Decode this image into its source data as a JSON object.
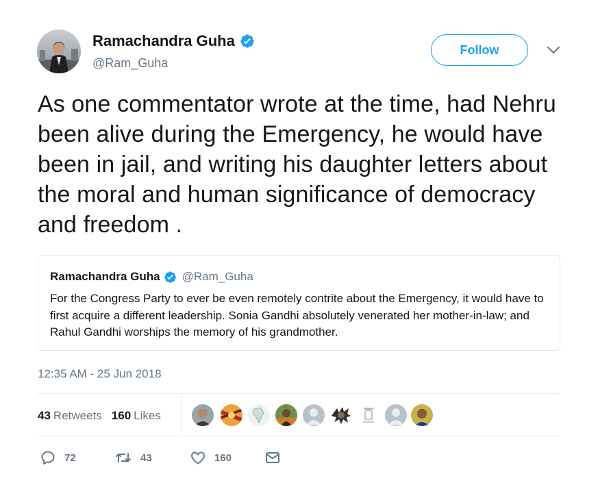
{
  "author": {
    "name": "Ramachandra Guha",
    "handle": "@Ram_Guha",
    "verified": true
  },
  "follow_label": "Follow",
  "tweet_text": "As one commentator wrote at the time, had Nehru been alive during the Emergency, he would have been in jail, and writing his daughter letters about the moral and human significance of democracy and freedom .",
  "quoted_tweet": {
    "name": "Ramachandra Guha",
    "handle": "@Ram_Guha",
    "text": "For the Congress Party to ever be even remotely contrite about the Emergency, it would have to first acquire a different leadership. Sonia Gandhi absolutely venerated her mother-in-law; and Rahul Gandhi worships the memory of his grandmother."
  },
  "timestamp": "12:35 AM - 25 Jun 2018",
  "stats": {
    "retweets_count": "43",
    "retweets_label": "Retweets",
    "likes_count": "160",
    "likes_label": "Likes"
  },
  "actions": {
    "reply_count": "72",
    "retweet_count": "43",
    "like_count": "160"
  },
  "colors": {
    "accent": "#1da1f2",
    "secondary_text": "#657786",
    "primary_text": "#14171a"
  },
  "icons": [
    "verified-badge-icon",
    "chevron-down-icon",
    "reply-icon",
    "retweet-icon",
    "heart-icon",
    "message-icon"
  ]
}
